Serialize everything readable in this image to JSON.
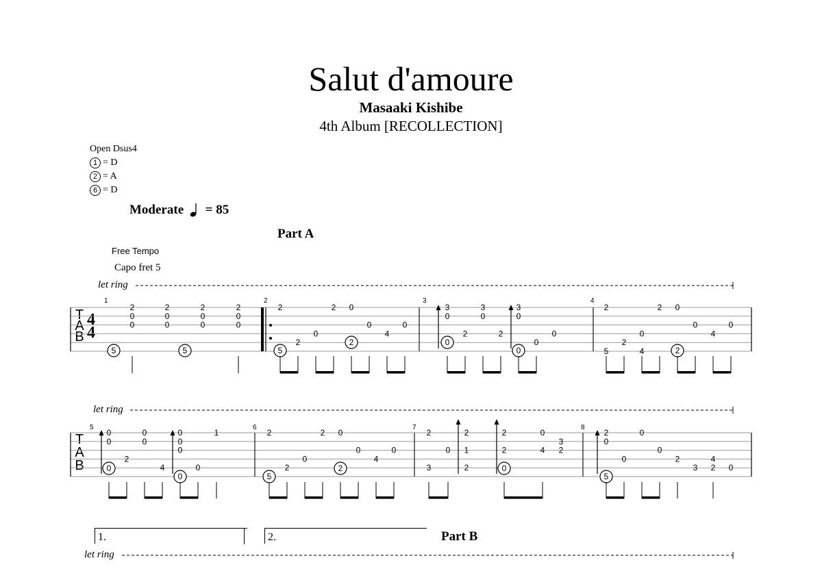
{
  "header": {
    "title": "Salut d'amoure",
    "composer": "Masaaki Kishibe",
    "album": "4th Album [RECOLLECTION]"
  },
  "tuning": {
    "name": "Open Dsus4",
    "strings": [
      {
        "num": "1",
        "note": "= D"
      },
      {
        "num": "2",
        "note": "= A"
      },
      {
        "num": "6",
        "note": "= D"
      }
    ]
  },
  "tempo": {
    "label": "Moderate",
    "bpm": "= 85"
  },
  "annotations": {
    "part_a": "Part A",
    "part_b": "Part B",
    "free_tempo": "Free Tempo",
    "capo": "Capo fret 5",
    "let_ring": "let ring",
    "volta_1": "1.",
    "volta_2": "2."
  },
  "tab_clef": [
    "T",
    "A",
    "B"
  ],
  "time_signature": [
    "4",
    "4"
  ],
  "bar_numbers": [
    "1",
    "2",
    "3",
    "4",
    "5",
    "6",
    "7",
    "8"
  ]
}
